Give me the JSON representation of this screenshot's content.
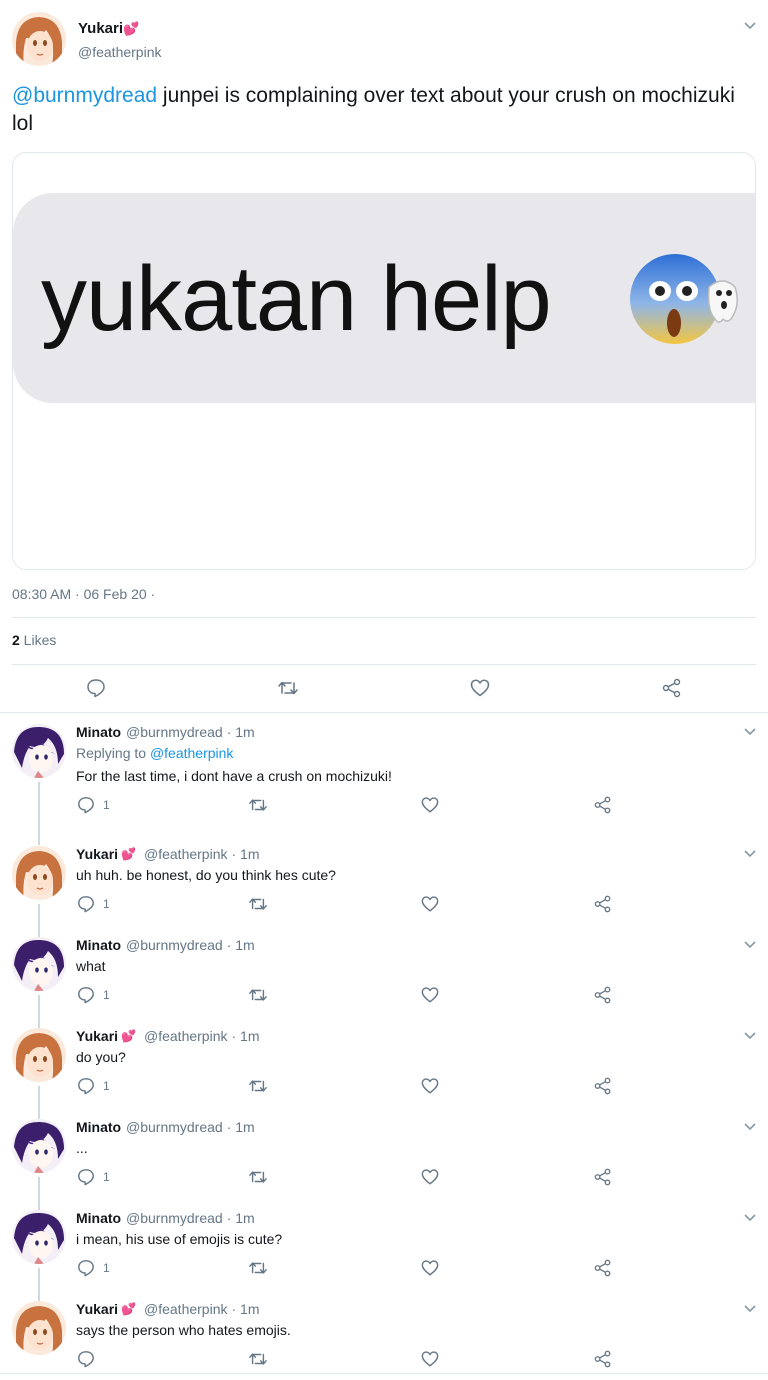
{
  "main_tweet": {
    "author_name": "Yukari",
    "author_emoji": "💕",
    "author_handle": "@featherpink",
    "mention": "@burnmydread",
    "text": " junpei is complaining over text about your crush on mochizuki lol",
    "media_text": "yukatan help",
    "timestamp": "08:30 AM · 06 Feb 20 ·",
    "likes_count": "2",
    "likes_label": " Likes",
    "colors": {
      "link": "#1b95e0",
      "secondary": "#657786",
      "border": "#e1e8ed",
      "heart": "#e0245e"
    }
  },
  "replies": [
    {
      "name": "Minato",
      "emoji": "",
      "handle": "@burnmydread",
      "time": "· 1m",
      "replying_to_prefix": "Replying to ",
      "replying_to": "@featherpink",
      "text": "For the last time, i dont have a crush on mochizuki!",
      "reply_count": "1",
      "avatar": "minato"
    },
    {
      "name": "Yukari",
      "emoji": "💕",
      "handle": "@featherpink",
      "time": "· 1m",
      "text": "uh huh. be honest, do you think hes cute?",
      "reply_count": "1",
      "avatar": "yukari"
    },
    {
      "name": "Minato",
      "emoji": "",
      "handle": "@burnmydread",
      "time": "· 1m",
      "text": "what",
      "reply_count": "1",
      "avatar": "minato"
    },
    {
      "name": "Yukari",
      "emoji": "💕",
      "handle": "@featherpink",
      "time": "· 1m",
      "text": "do you?",
      "reply_count": "1",
      "avatar": "yukari"
    },
    {
      "name": "Minato",
      "emoji": "",
      "handle": "@burnmydread",
      "time": "· 1m",
      "text": "...",
      "reply_count": "1",
      "avatar": "minato"
    },
    {
      "name": "Minato",
      "emoji": "",
      "handle": "@burnmydread",
      "time": "· 1m",
      "text": "i mean, his use of emojis is cute?",
      "reply_count": "1",
      "avatar": "minato"
    },
    {
      "name": "Yukari",
      "emoji": "💕",
      "handle": "@featherpink",
      "time": "· 1m",
      "text": "says the person who hates emojis.",
      "reply_count": "",
      "avatar": "yukari"
    }
  ],
  "icons": {
    "actions": [
      "reply-icon",
      "retweet-icon",
      "like-icon",
      "share-icon"
    ],
    "menu": "chevron-down-icon",
    "media_emoji": "face-screaming-in-fear-emoji"
  }
}
